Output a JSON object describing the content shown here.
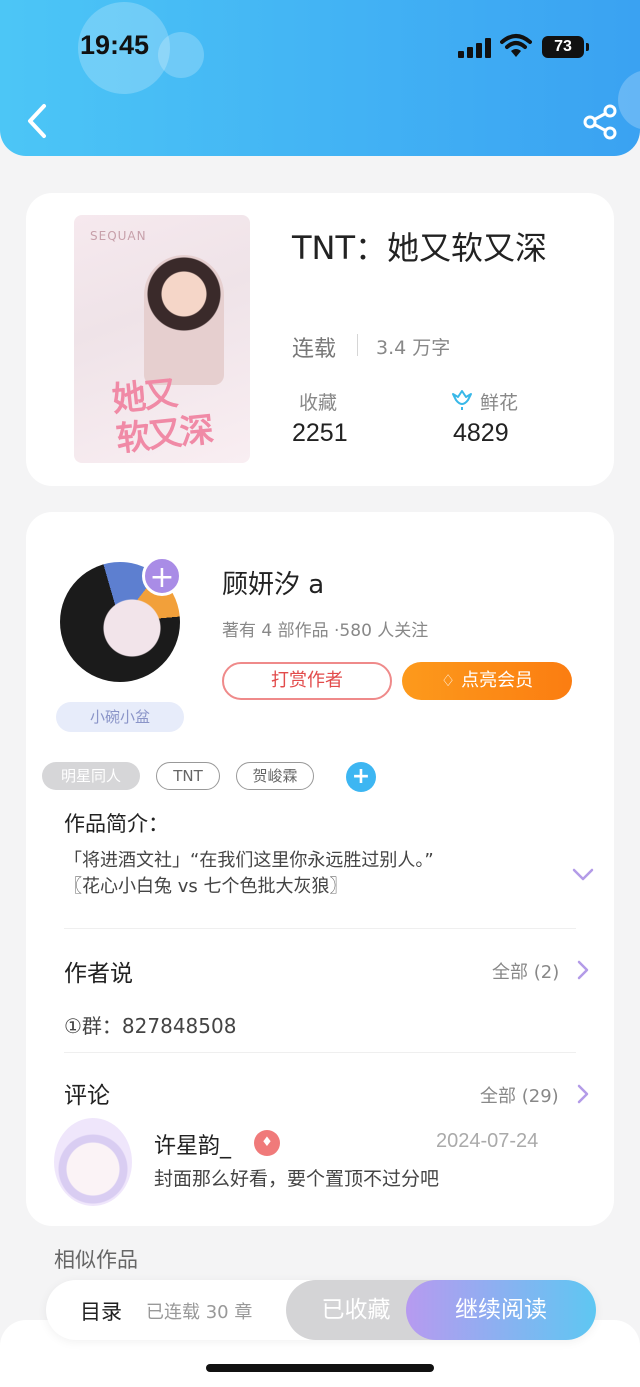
{
  "status_bar": {
    "time": "19:45",
    "battery": "73"
  },
  "book": {
    "title": "TNT：她又软又深",
    "cover_brand": "SEQUAN",
    "cover_title": "她又\n软又深",
    "status": "连载",
    "words": "3.4 万字",
    "favorites_label": "收藏",
    "favorites_value": "2251",
    "flowers_label": "鲜花",
    "flowers_value": "4829"
  },
  "author": {
    "name": "顾妍汐 a",
    "meta": "著有 4 部作品 ·580 人关注",
    "avatar_tag": "小碗小盆",
    "tip_label": "打赏作者",
    "vip_label": "点亮会员"
  },
  "tags": [
    "明星同人",
    "TNT",
    "贺峻霖"
  ],
  "intro": {
    "title": "作品简介：",
    "lines": [
      "「将进酒文社」“在我们这里你永远胜过别人。”",
      "〖花心小白兔 vs 七个色批大灰狼〗"
    ]
  },
  "author_says": {
    "title": "作者说",
    "all_label": "全部 (2)",
    "text": "①群：827848508"
  },
  "comments": {
    "title": "评论",
    "all_label": "全部 (29)",
    "items": [
      {
        "user": "许星韵_",
        "date": "2024-07-24",
        "text": "封面那么好看，要个置顶不过分吧"
      }
    ]
  },
  "similar_title": "相似作品",
  "bottom_bar": {
    "toc_label": "目录",
    "chapter_count": "已连载 30 章",
    "favorited_label": "已收藏",
    "continue_label": "继续阅读"
  },
  "colors": {
    "header_start": "#4cc6f6",
    "header_end": "#3aa2f2",
    "vip_orange": "#fb7d11",
    "tip_red": "#e24b4b",
    "accent_purple": "#a98ce6"
  }
}
